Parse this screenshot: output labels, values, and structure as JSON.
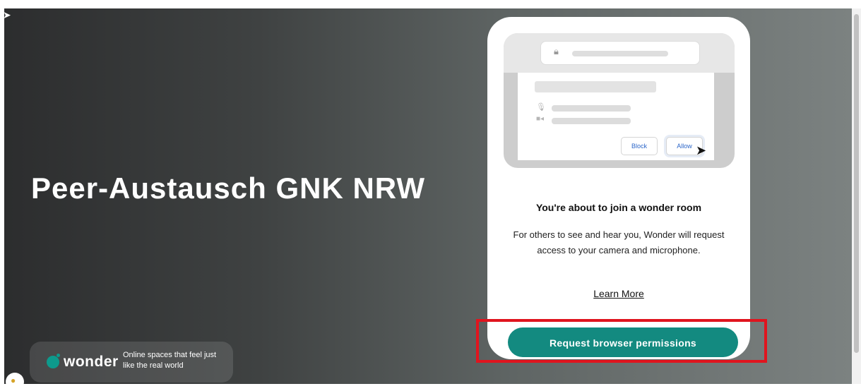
{
  "room": {
    "title": "Peer-Austausch GNK NRW"
  },
  "brand": {
    "name": "wonder",
    "tagline": "Online spaces that feel just like the real world"
  },
  "illustration": {
    "block_label": "Block",
    "allow_label": "Allow",
    "lock_icon": "lock-icon",
    "mic_icon": "microphone-icon",
    "camera_icon": "camera-icon"
  },
  "permission_card": {
    "heading": "You're about to join a wonder room",
    "description": "For others to see and hear you, Wonder will request access to your camera and microphone.",
    "learn_more": "Learn More",
    "request_button": "Request browser permissions"
  },
  "colors": {
    "accent": "#138a80",
    "brand_dot": "#0d9a8c",
    "highlight": "#e0141e"
  }
}
